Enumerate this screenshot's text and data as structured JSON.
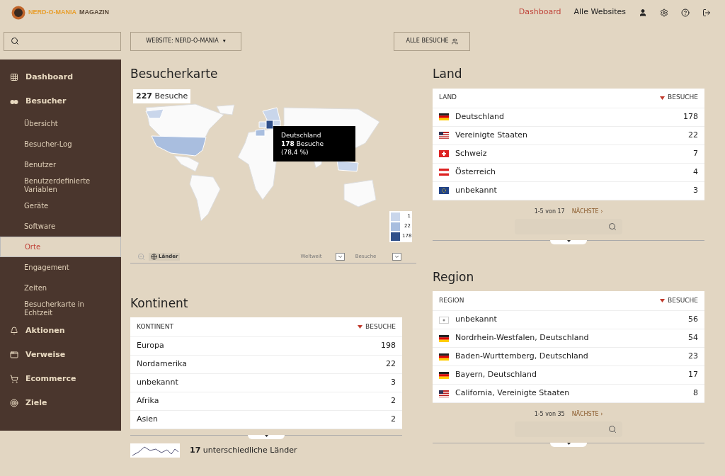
{
  "logo": {
    "name": "NERD-O-MANIA",
    "suffix": "MAGAZIN"
  },
  "top_nav": [
    {
      "label": "Dashboard",
      "selected": true
    },
    {
      "label": "Alle Websites",
      "selected": false
    }
  ],
  "site_selector": {
    "label": "WEBSITE: NERD-O-MANIA",
    "caret": "▾"
  },
  "segment_button": {
    "label": "ALLE BESUCHE"
  },
  "sidebar": [
    {
      "label": "Dashboard"
    },
    {
      "label": "Besucher",
      "children": [
        {
          "label": "Übersicht",
          "selected": false
        },
        {
          "label": "Besucher-Log",
          "selected": false
        },
        {
          "label": "Benutzer",
          "selected": false
        },
        {
          "label": "Benutzerdefinierte Variablen",
          "selected": false
        },
        {
          "label": "Geräte",
          "selected": false
        },
        {
          "label": "Software",
          "selected": false
        },
        {
          "label": "Orte",
          "selected": true
        },
        {
          "label": "Engagement",
          "selected": false
        },
        {
          "label": "Zeiten",
          "selected": false
        },
        {
          "label": "Besucherkarte in Echtzeit",
          "selected": false
        }
      ]
    },
    {
      "label": "Aktionen"
    },
    {
      "label": "Verweise"
    },
    {
      "label": "Ecommerce"
    },
    {
      "label": "Ziele"
    }
  ],
  "map": {
    "title": "Besucherkarte",
    "total_count": "227",
    "total_label": "Besuche",
    "tooltip": {
      "country": "Deutschland",
      "count": "178",
      "label": "Besuche",
      "share": "(78,4 %)"
    },
    "legend": [
      {
        "value": "1",
        "color": "#c9d6eb"
      },
      {
        "value": "22",
        "color": "#a9bedf"
      },
      {
        "value": "178",
        "color": "#2f4f8a"
      }
    ],
    "mode_button": "Länder",
    "region_select": "Weltweit",
    "metric_select": "Besuche"
  },
  "continent": {
    "title": "Kontinent",
    "columns": [
      "KONTINENT",
      "BESUCHE"
    ],
    "rows": [
      {
        "label": "Europa",
        "value": "198"
      },
      {
        "label": "Nordamerika",
        "value": "22"
      },
      {
        "label": "unbekannt",
        "value": "3"
      },
      {
        "label": "Afrika",
        "value": "2"
      },
      {
        "label": "Asien",
        "value": "2"
      }
    ],
    "summary_count": "17",
    "summary_label": "unterschiedliche Länder"
  },
  "land": {
    "title": "Land",
    "columns": [
      "LAND",
      "BESUCHE"
    ],
    "rows": [
      {
        "label": "Deutschland",
        "value": "178"
      },
      {
        "label": "Vereinigte Staaten",
        "value": "22"
      },
      {
        "label": "Schweiz",
        "value": "7"
      },
      {
        "label": "Österreich",
        "value": "4"
      },
      {
        "label": "unbekannt",
        "value": "3"
      }
    ],
    "pagination": "1-5 von 17",
    "next": "NÄCHSTE ›"
  },
  "region": {
    "title": "Region",
    "columns": [
      "REGION",
      "BESUCHE"
    ],
    "rows": [
      {
        "label": "unbekannt",
        "value": "56"
      },
      {
        "label": "Nordrhein-Westfalen, Deutschland",
        "value": "54"
      },
      {
        "label": "Baden-Wurttemberg, Deutschland",
        "value": "23"
      },
      {
        "label": "Bayern, Deutschland",
        "value": "17"
      },
      {
        "label": "California, Vereinigte Staaten",
        "value": "8"
      }
    ],
    "pagination": "1-5 von 35",
    "next": "NÄCHSTE ›"
  }
}
